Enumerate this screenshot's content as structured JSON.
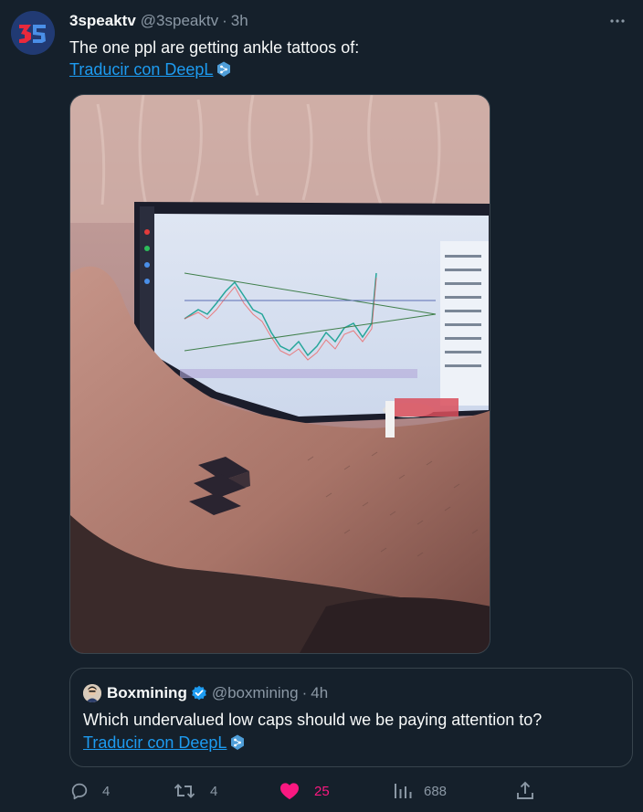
{
  "tweet": {
    "display_name": "3speaktv",
    "handle": "@3speaktv",
    "separator": "·",
    "time": "3h",
    "text": "The one ppl are getting ankle tattoos of:",
    "translate_label": "Traducir con DeepL"
  },
  "quote": {
    "display_name": "Boxmining",
    "handle": "@boxmining",
    "separator": "·",
    "time": "4h",
    "text": "Which undervalued low caps should we be paying attention to?",
    "translate_label": "Traducir con DeepL"
  },
  "actions": {
    "replies": "4",
    "reposts": "4",
    "likes": "25",
    "views": "688"
  },
  "colors": {
    "background": "#15202b",
    "link": "#1d9bf0",
    "muted": "#8b98a5",
    "like": "#f91880",
    "border": "#38444d"
  },
  "icons": [
    "3speak-avatar",
    "more-icon",
    "deepl-icon",
    "verified-badge-icon",
    "reply-icon",
    "repost-icon",
    "heart-icon",
    "views-icon",
    "share-icon"
  ]
}
